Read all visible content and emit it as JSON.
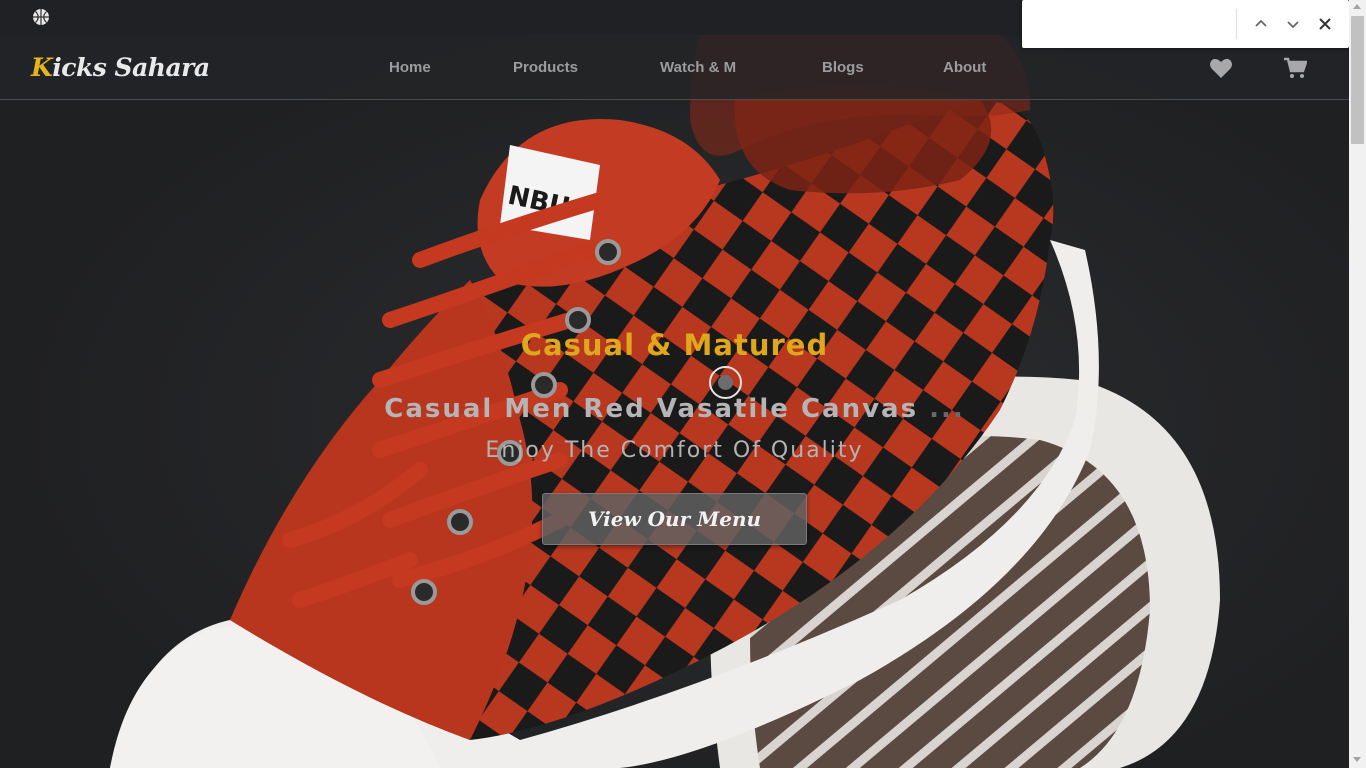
{
  "brand": {
    "initial": "K",
    "rest": "icks Sahara"
  },
  "nav": {
    "items": [
      {
        "label": "Home"
      },
      {
        "label": "Products"
      },
      {
        "label": "Watch & M"
      },
      {
        "label": "Blogs"
      },
      {
        "label": "About"
      }
    ],
    "icons": [
      "heart-icon",
      "cart-icon"
    ]
  },
  "hero": {
    "accent": "Casual & Matured",
    "title": "Casual Men Red Vasatile Canvas",
    "title_ellipsis": " ...",
    "subtitle": "Enjoy The Comfort Of Quality",
    "cta": "View Our Menu"
  },
  "find_bar": {
    "value": ""
  },
  "colors": {
    "accent": "#e0a61c",
    "shoe_red": "#c0392b",
    "background": "#232427"
  }
}
